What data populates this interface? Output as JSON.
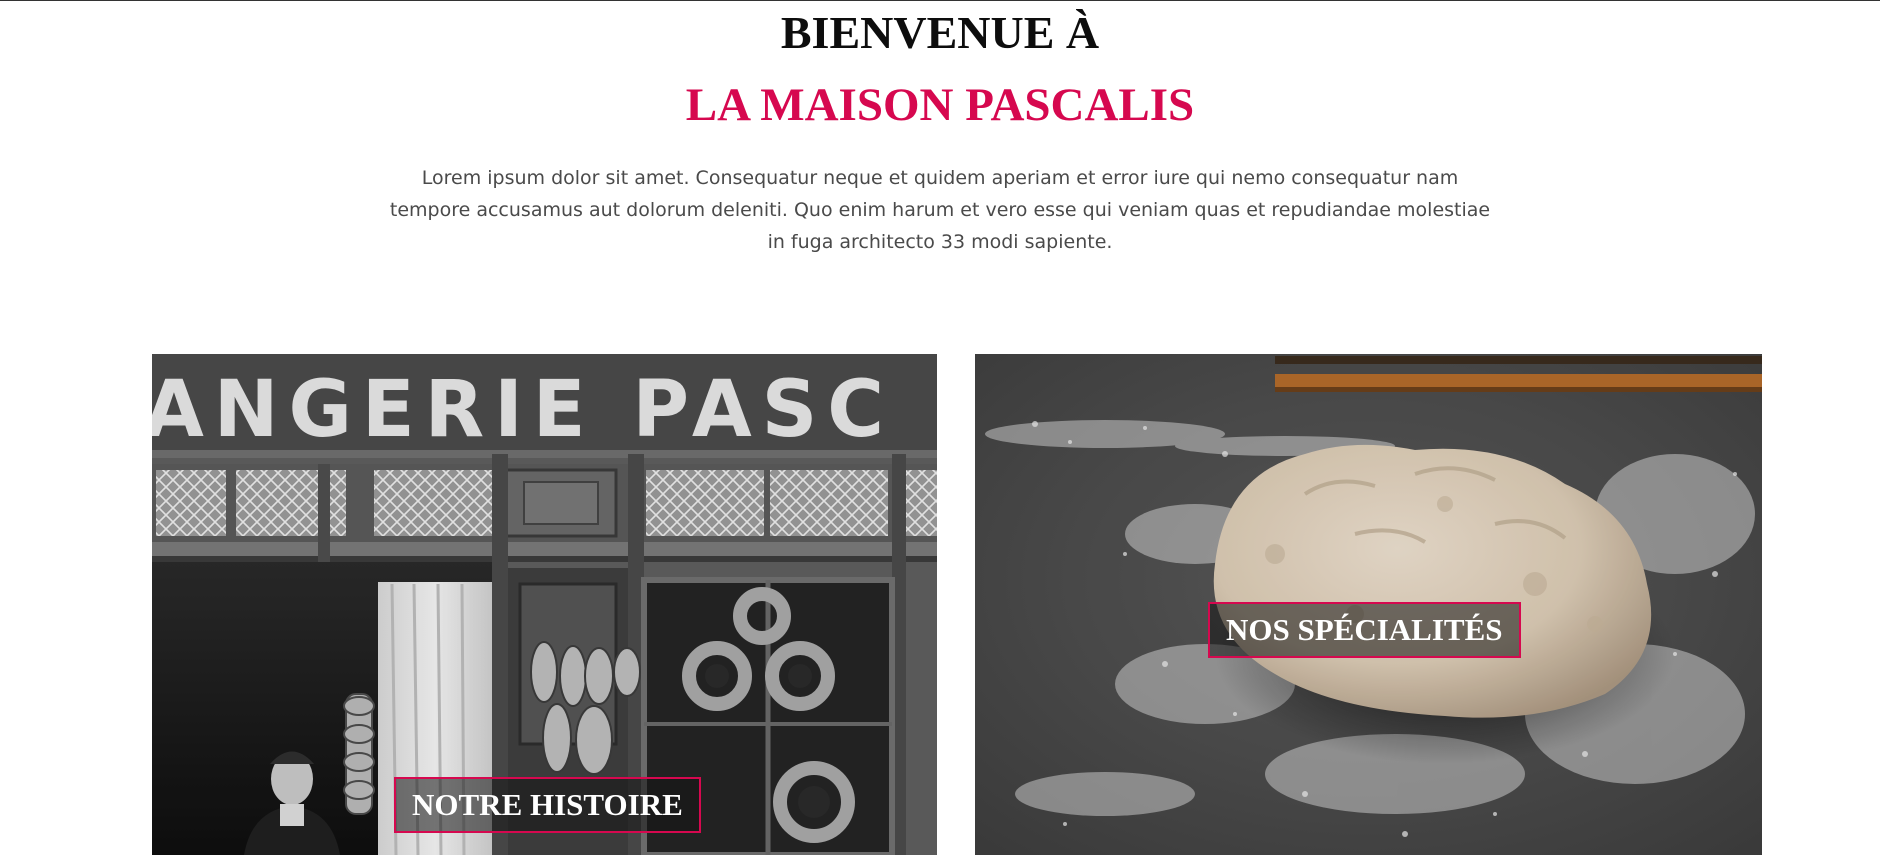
{
  "hero": {
    "title_line1": "BIENVENUE À",
    "title_line2": "LA MAISON PASCALIS",
    "intro_text": "Lorem ipsum dolor sit amet. Consequatur neque et quidem aperiam et error iure qui nemo consequatur nam tempore accusamus aut dolorum deleniti. Quo enim harum et vero esse qui veniam quas et repudiandae molestiae in fuga architecto 33 modi sapiente."
  },
  "cards": [
    {
      "label": "NOTRE HISTOIRE",
      "sign_text": "ANGERIE  PASC"
    },
    {
      "label": "NOS SPÉCIALITÉS"
    }
  ],
  "colors": {
    "accent": "#d6084f",
    "heading": "#0d0d0d",
    "body_text": "#4a4a4a"
  }
}
